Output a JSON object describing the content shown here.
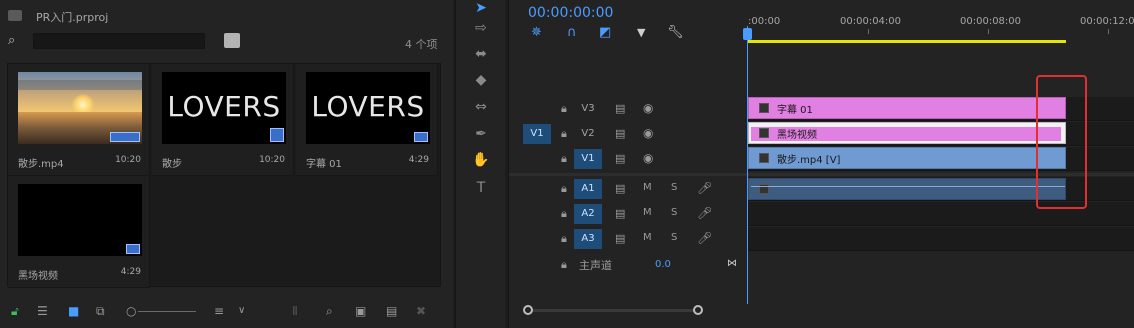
{
  "project": {
    "title": "PR入门.prproj",
    "search_value": "",
    "item_count": "4 个项",
    "items": [
      {
        "name": "散步.mp4",
        "duration": "10:20",
        "kind": "sunset"
      },
      {
        "name": "散步",
        "duration": "10:20",
        "kind": "text",
        "thumb_text": "LOVERS"
      },
      {
        "name": "字幕 01",
        "duration": "4:29",
        "kind": "text",
        "thumb_text": "LOVERS"
      },
      {
        "name": "黑场视频",
        "duration": "4:29",
        "kind": "black"
      }
    ],
    "footer_icons": [
      "lock-icon",
      "list-view-icon",
      "icon-view-icon",
      "freeform-view-icon",
      "zoom-slider",
      "sort-icon",
      "automate-icon",
      "find-icon",
      "new-bin-icon",
      "new-item-icon",
      "clear-icon"
    ]
  },
  "tools": [
    "selection-tool",
    "track-select-tool",
    "ripple-edit-tool",
    "razor-tool",
    "slip-tool",
    "pen-tool",
    "hand-tool",
    "type-tool"
  ],
  "timeline": {
    "timecode": "00:00:00:00",
    "ruler": [
      ":00:00",
      "00:00:04:00",
      "00:00:08:00",
      "00:00:12:00"
    ],
    "video_tracks": [
      {
        "name": "V3",
        "source": "",
        "target": false
      },
      {
        "name": "V2",
        "source": "V1",
        "target": false
      },
      {
        "name": "V1",
        "source": "",
        "target": true
      }
    ],
    "audio_tracks": [
      {
        "name": "A1",
        "m": "M",
        "s": "S"
      },
      {
        "name": "A2",
        "m": "M",
        "s": "S"
      },
      {
        "name": "A3",
        "m": "M",
        "s": "S"
      }
    ],
    "clips": {
      "v3": "字幕 01",
      "v2": "黑场视频",
      "v1": "散步.mp4 [V]"
    },
    "master_label": "主声道",
    "master_value": "0.0",
    "colors": {
      "accent": "#4b9cff",
      "title_clip": "#e27fe2",
      "video_clip": "#6f9ad2",
      "audio_clip": "#3e5b80",
      "work_area": "#e5e500",
      "highlight": "#e03030"
    }
  }
}
